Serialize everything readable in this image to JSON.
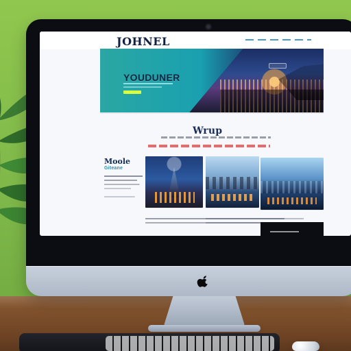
{
  "site": {
    "logo_text": "JOHNEL",
    "hero": {
      "title": "YOUDUNER"
    },
    "section": {
      "title": "Wrup"
    },
    "left_column": {
      "title": "Moole",
      "subtitle": "Giteane"
    }
  },
  "colors": {
    "background_green": "#7fb84a",
    "hero_teal": "#1aa0b0",
    "hero_cta_lime": "#d7ff3f",
    "section_title_navy": "#1a2c59",
    "red_text_line": "#e73d3d"
  },
  "icons": {
    "apple": "apple-logo"
  }
}
